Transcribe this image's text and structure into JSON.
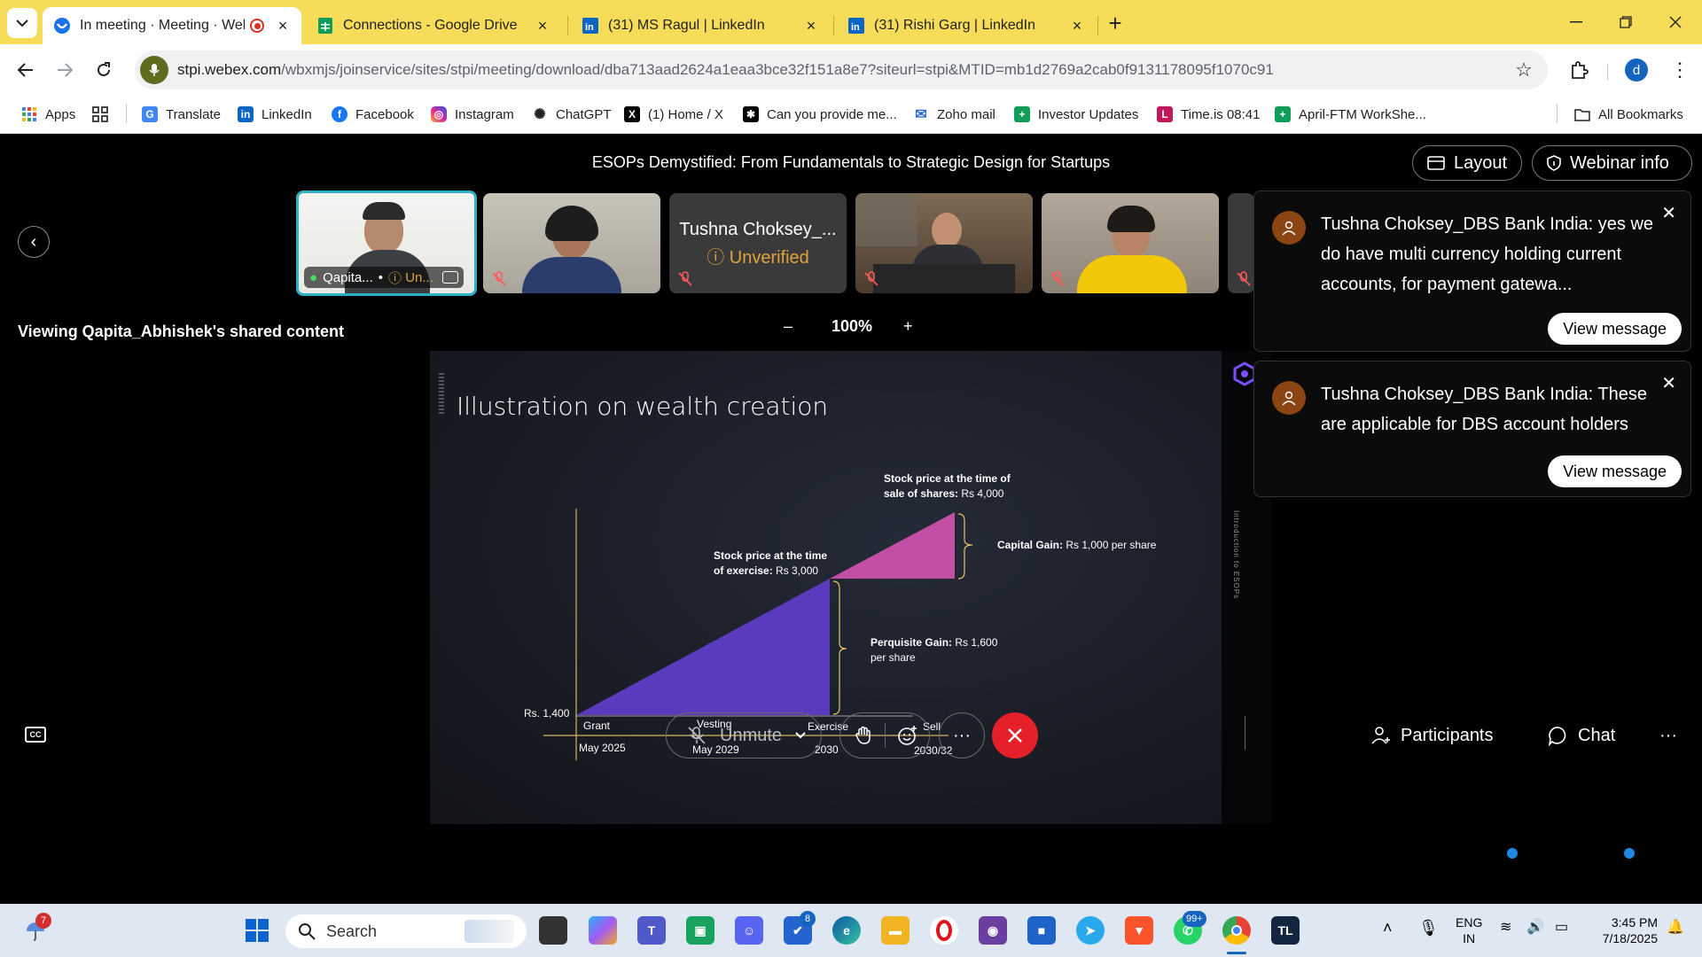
{
  "browser": {
    "tabs": [
      {
        "title": "In meeting · Meeting · Webex",
        "active": true,
        "favicon": "webex-icon"
      },
      {
        "title": "Connections - Google Drive",
        "active": false,
        "favicon": "sheets-icon"
      },
      {
        "title": "(31) MS Ragul | LinkedIn",
        "active": false,
        "favicon": "linkedin-icon"
      },
      {
        "title": "(31) Rishi Garg | LinkedIn",
        "active": false,
        "favicon": "linkedin-icon"
      }
    ],
    "url_host": "stpi.webex.com",
    "url_path": "/wbxmjs/joinservice/sites/stpi/meeting/download/dba713aad2624a1eaa3bce32f151a8e7?siteurl=stpi&MTID=mb1d2769a2cab0f9131178095f1070c91",
    "profile_initial": "d",
    "bookmarks": [
      {
        "label": "Apps",
        "icon": "apps-grid-icon",
        "color": "#4285f4"
      },
      {
        "label": "",
        "icon": "tab-groups-icon",
        "color": "#333333"
      },
      {
        "label": "Translate",
        "icon": "translate-icon",
        "color": "#4285f4"
      },
      {
        "label": "LinkedIn",
        "icon": "linkedin-icon",
        "color": "#0a66c2"
      },
      {
        "label": "Facebook",
        "icon": "facebook-icon",
        "color": "#1877f2"
      },
      {
        "label": "Instagram",
        "icon": "instagram-icon",
        "color": "#d6249f"
      },
      {
        "label": "ChatGPT",
        "icon": "chatgpt-icon",
        "color": "#202124"
      },
      {
        "label": "(1) Home / X",
        "icon": "x-icon",
        "color": "#000000"
      },
      {
        "label": "Can you provide me...",
        "icon": "notion-icon",
        "color": "#000000"
      },
      {
        "label": "Zoho mail",
        "icon": "zoho-mail-icon",
        "color": "#2a6ad8"
      },
      {
        "label": "Investor Updates",
        "icon": "sheets-icon",
        "color": "#0f9d58"
      },
      {
        "label": "Time.is 08:41",
        "icon": "timeis-icon",
        "color": "#c2185b"
      },
      {
        "label": "April-FTM WorkShe...",
        "icon": "sheets-icon",
        "color": "#0f9d58"
      }
    ],
    "all_bookmarks": "All Bookmarks"
  },
  "meeting": {
    "title": "ESOPs Demystified: From Fundamentals to Strategic Design for Startups",
    "layout_label": "Layout",
    "webinar_info_label": "Webinar info",
    "participants": [
      {
        "name": "Qapita...",
        "status": "Un...",
        "active": true
      },
      {
        "name": "",
        "status": "",
        "active": false
      },
      {
        "name": "Tushna Choksey_...",
        "status": "Unverified",
        "active": false
      },
      {
        "name": "",
        "status": "",
        "active": false
      },
      {
        "name": "",
        "status": "",
        "active": false
      }
    ],
    "viewing_text": "Viewing Qapita_Abhishek's shared content",
    "zoom_minus": "–",
    "zoom_level": "100%",
    "zoom_plus": "+",
    "notifications": [
      {
        "text": "Tushna Choksey_DBS Bank India: yes we do have multi currency holding current accounts, for payment gatewa...",
        "button": "View message"
      },
      {
        "text": "Tushna Choksey_DBS Bank India: These are applicable for DBS account holders",
        "button": "View message"
      }
    ],
    "controls": {
      "unmute": "Unmute",
      "participants": "Participants",
      "chat": "Chat",
      "more": "···"
    }
  },
  "slide": {
    "title": "Illustration on wealth creation",
    "side_text": "Introduction to ESOPs",
    "start_price_label": "Rs. 1,400",
    "stages": [
      "Grant",
      "Vesting",
      "Exercise",
      "Sell"
    ],
    "dates": [
      "May 2025",
      "May 2029",
      "2030",
      "2030/32"
    ],
    "exercise_label_bold_1": "Stock price at the time",
    "exercise_label_bold_2": "of exercise:",
    "exercise_value": "Rs 3,000",
    "sale_label_bold_1": "Stock price at the time of",
    "sale_label_bold_2": "sale of shares:",
    "sale_value": "Rs 4,000",
    "capital_gain_bold": "Capital Gain:",
    "capital_gain_value": "Rs 1,000 per share",
    "perquisite_bold": "Perquisite Gain:",
    "perquisite_value_1": "Rs 1,600",
    "perquisite_value_2": "per share",
    "colors": {
      "exercise": "#5b3bbd",
      "sale": "#c24fa3",
      "brace": "#e8c468"
    }
  },
  "taskbar": {
    "search_placeholder": "Search",
    "weather_badge": "7",
    "chat_badge": "99+",
    "todo_badge": "8",
    "lang_1": "ENG",
    "lang_2": "IN",
    "time": "3:45 PM",
    "date": "7/18/2025"
  }
}
